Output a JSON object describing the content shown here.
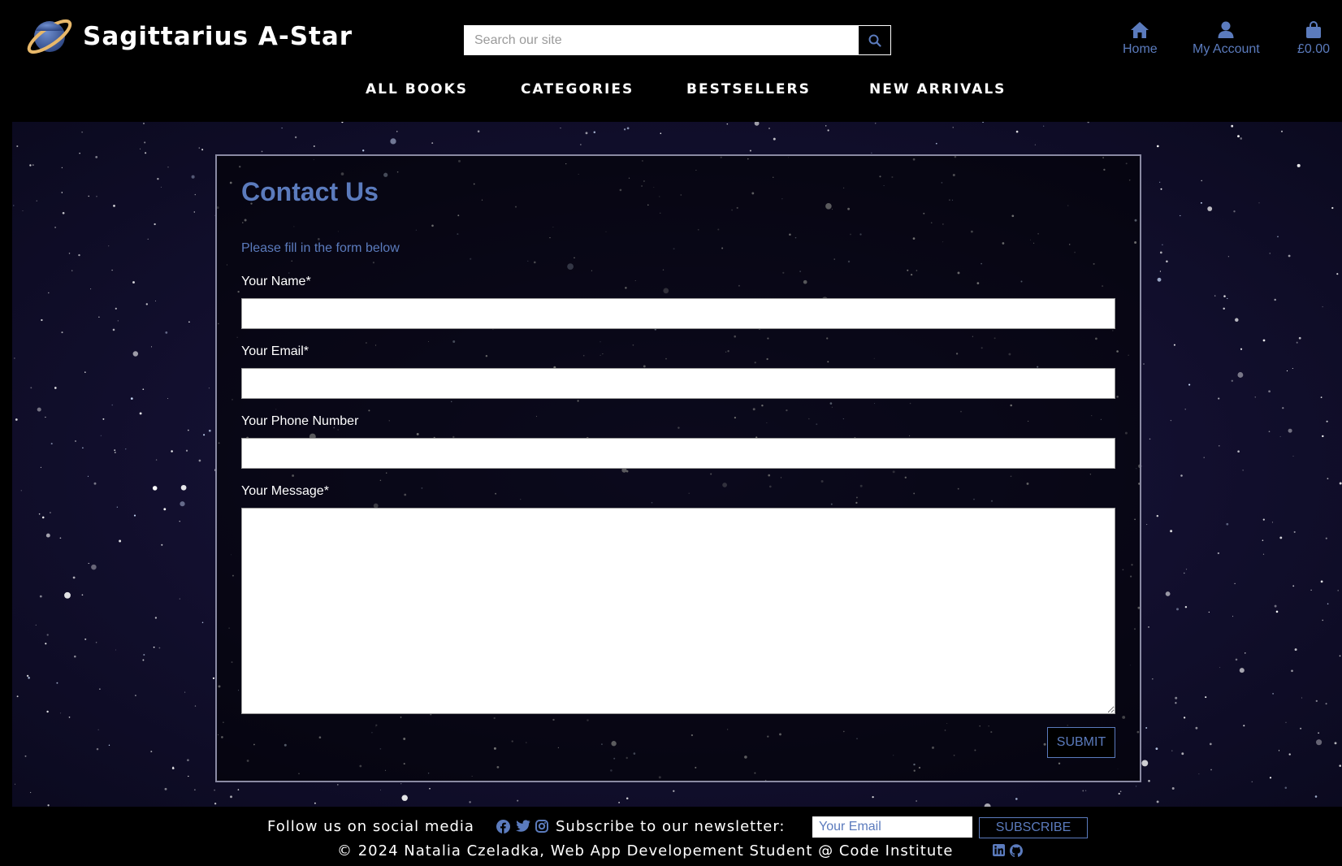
{
  "header": {
    "logo_text": "Sagittarius A-Star",
    "search_placeholder": "Search our site",
    "nav_icons": {
      "home": "Home",
      "account": "My Account",
      "bag_total": "£0.00"
    },
    "main_nav": [
      "ALL BOOKS",
      "CATEGORIES",
      "BESTSELLERS",
      "NEW ARRIVALS"
    ]
  },
  "contact": {
    "title": "Contact Us",
    "subtitle": "Please fill in the form below",
    "fields": {
      "name_label": "Your Name*",
      "email_label": "Your Email*",
      "phone_label": "Your Phone Number",
      "message_label": "Your Message*"
    },
    "submit_label": "SUBMIT"
  },
  "footer": {
    "follow_text": "Follow us on social media",
    "subscribe_text": "Subscribe to our newsletter:",
    "newsletter_placeholder": "Your Email",
    "subscribe_button": "SUBSCRIBE",
    "copyright": "© 2024 Natalia Czeladka, Web App Developement Student @ Code Institute"
  },
  "colors": {
    "accent": "#5b7bbd",
    "background": "#000000",
    "space": "#120f2e",
    "panel_border": "#8a8aa3"
  },
  "icons": [
    "planet-logo-icon",
    "search-icon",
    "home-icon",
    "user-icon",
    "shopping-bag-icon",
    "facebook-icon",
    "twitter-icon",
    "instagram-icon",
    "linkedin-icon",
    "github-icon"
  ]
}
